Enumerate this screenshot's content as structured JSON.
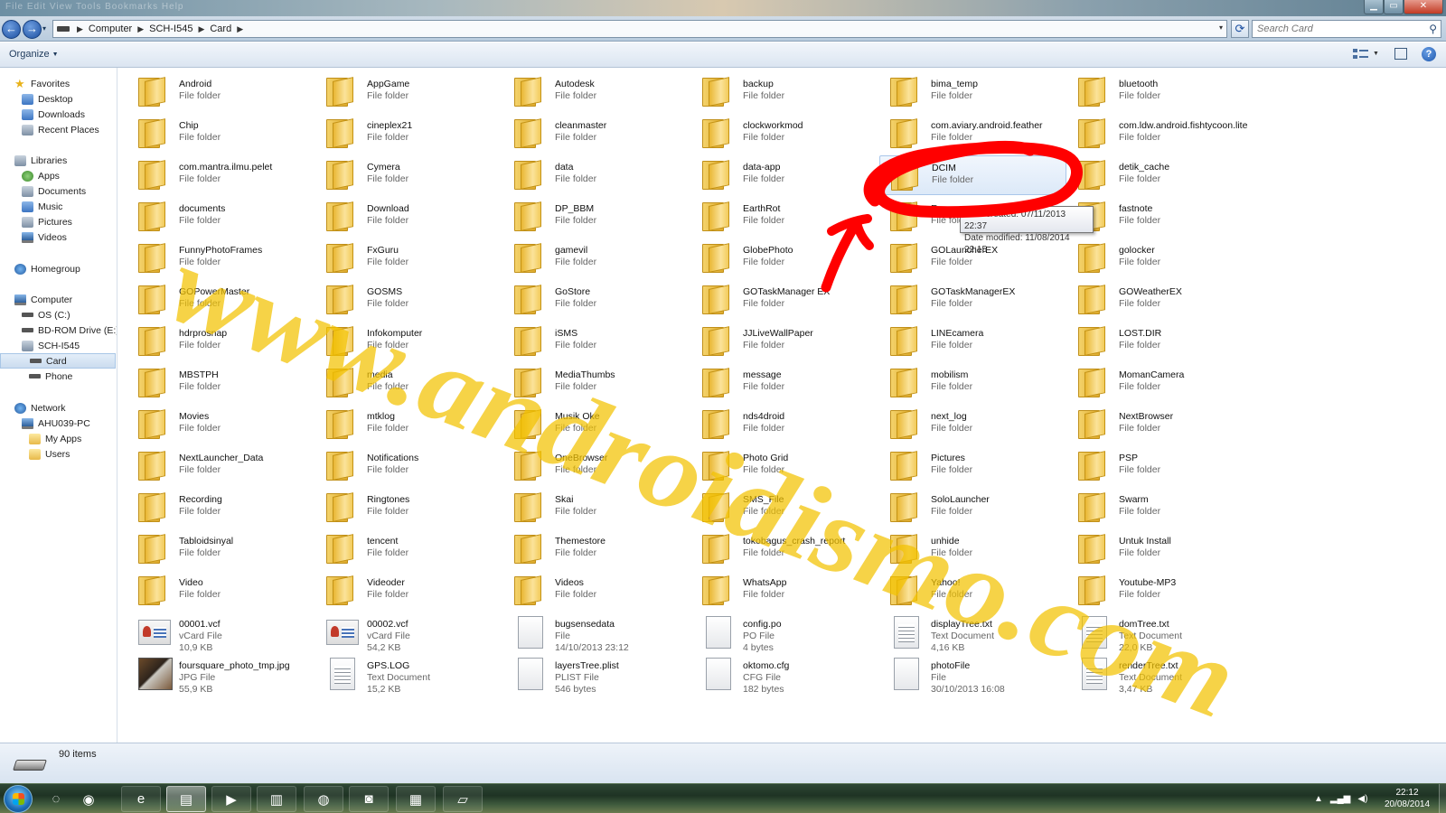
{
  "window": {
    "menu_hint": "File  Edit  View  Tools  Bookmarks  Help",
    "minimize_glyph": "▁",
    "maximize_glyph": "▭",
    "close_glyph": "✕"
  },
  "navigation": {
    "back_glyph": "←",
    "forward_glyph": "→",
    "dropdown_glyph": "▾",
    "breadcrumb": [
      "Computer",
      "SCH-I545",
      "Card"
    ],
    "refresh_glyph": "⟳",
    "search_placeholder": "Search Card",
    "search_icon": "search-icon"
  },
  "toolbar": {
    "organize_label": "Organize",
    "organize_arrow": "▼",
    "views_arrow": "▼",
    "help_label": "?"
  },
  "nav_pane": {
    "items": [
      {
        "label": "Favorites",
        "level": 0,
        "icon": "star",
        "header": true
      },
      {
        "label": "Desktop",
        "level": 1,
        "icon": "folder-blue"
      },
      {
        "label": "Downloads",
        "level": 1,
        "icon": "folder-blue"
      },
      {
        "label": "Recent Places",
        "level": 1,
        "icon": "lib"
      },
      {
        "label": "Libraries",
        "level": 0,
        "icon": "lib",
        "header": true
      },
      {
        "label": "Apps",
        "level": 1,
        "icon": "green"
      },
      {
        "label": "Documents",
        "level": 1,
        "icon": "lib"
      },
      {
        "label": "Music",
        "level": 1,
        "icon": "folder-blue"
      },
      {
        "label": "Pictures",
        "level": 1,
        "icon": "lib"
      },
      {
        "label": "Videos",
        "level": 1,
        "icon": "pc"
      },
      {
        "label": "Homegroup",
        "level": 0,
        "icon": "net",
        "header": true
      },
      {
        "label": "Computer",
        "level": 0,
        "icon": "pc",
        "header": true
      },
      {
        "label": "OS (C:)",
        "level": 1,
        "icon": "drive"
      },
      {
        "label": "BD-ROM Drive (E:) S",
        "level": 1,
        "icon": "drive"
      },
      {
        "label": "SCH-I545",
        "level": 1,
        "icon": "lib"
      },
      {
        "label": "Card",
        "level": 2,
        "icon": "drive",
        "selected": true
      },
      {
        "label": "Phone",
        "level": 2,
        "icon": "drive"
      },
      {
        "label": "Network",
        "level": 0,
        "icon": "net",
        "header": true
      },
      {
        "label": "AHU039-PC",
        "level": 1,
        "icon": "pc"
      },
      {
        "label": "My Apps",
        "level": 2,
        "icon": "folder-y"
      },
      {
        "label": "Users",
        "level": 2,
        "icon": "folder-y"
      }
    ]
  },
  "files": [
    {
      "name": "Android",
      "type": "File folder"
    },
    {
      "name": "AppGame",
      "type": "File folder"
    },
    {
      "name": "Autodesk",
      "type": "File folder"
    },
    {
      "name": "backup",
      "type": "File folder"
    },
    {
      "name": "bima_temp",
      "type": "File folder"
    },
    {
      "name": "bluetooth",
      "type": "File folder"
    },
    {
      "name": "Chip",
      "type": "File folder"
    },
    {
      "name": "cineplex21",
      "type": "File folder"
    },
    {
      "name": "cleanmaster",
      "type": "File folder"
    },
    {
      "name": "clockworkmod",
      "type": "File folder"
    },
    {
      "name": "com.aviary.android.feather",
      "type": "File folder"
    },
    {
      "name": "com.ldw.android.fishtycoon.lite",
      "type": "File folder"
    },
    {
      "name": "com.mantra.ilmu.pelet",
      "type": "File folder"
    },
    {
      "name": "Cymera",
      "type": "File folder"
    },
    {
      "name": "data",
      "type": "File folder"
    },
    {
      "name": "data-app",
      "type": "File folder"
    },
    {
      "name": "DCIM",
      "type": "File folder",
      "selected": true
    },
    {
      "name": "detik_cache",
      "type": "File folder"
    },
    {
      "name": "documents",
      "type": "File folder"
    },
    {
      "name": "Download",
      "type": "File folder"
    },
    {
      "name": "DP_BBM",
      "type": "File folder"
    },
    {
      "name": "EarthRot",
      "type": "File folder"
    },
    {
      "name": "Emu",
      "type": "File folder"
    },
    {
      "name": "fastnote",
      "type": "File folder"
    },
    {
      "name": "FunnyPhotoFrames",
      "type": "File folder"
    },
    {
      "name": "FxGuru",
      "type": "File folder"
    },
    {
      "name": "gamevil",
      "type": "File folder"
    },
    {
      "name": "GlobePhoto",
      "type": "File folder"
    },
    {
      "name": "GOLauncherEX",
      "type": "File folder"
    },
    {
      "name": "golocker",
      "type": "File folder"
    },
    {
      "name": "GOPowerMaster",
      "type": "File folder"
    },
    {
      "name": "GOSMS",
      "type": "File folder"
    },
    {
      "name": "GoStore",
      "type": "File folder"
    },
    {
      "name": "GOTaskManager EX",
      "type": "File folder"
    },
    {
      "name": "GOTaskManagerEX",
      "type": "File folder"
    },
    {
      "name": "GOWeatherEX",
      "type": "File folder"
    },
    {
      "name": "hdrprosnap",
      "type": "File folder"
    },
    {
      "name": "Infokomputer",
      "type": "File folder"
    },
    {
      "name": "iSMS",
      "type": "File folder"
    },
    {
      "name": "JJLiveWallPaper",
      "type": "File folder"
    },
    {
      "name": "LINEcamera",
      "type": "File folder"
    },
    {
      "name": "LOST.DIR",
      "type": "File folder"
    },
    {
      "name": "MBSTPH",
      "type": "File folder"
    },
    {
      "name": "media",
      "type": "File folder"
    },
    {
      "name": "MediaThumbs",
      "type": "File folder"
    },
    {
      "name": "message",
      "type": "File folder"
    },
    {
      "name": "mobilism",
      "type": "File folder"
    },
    {
      "name": "MomanCamera",
      "type": "File folder"
    },
    {
      "name": "Movies",
      "type": "File folder"
    },
    {
      "name": "mtklog",
      "type": "File folder"
    },
    {
      "name": "Musik Oke",
      "type": "File folder"
    },
    {
      "name": "nds4droid",
      "type": "File folder"
    },
    {
      "name": "next_log",
      "type": "File folder"
    },
    {
      "name": "NextBrowser",
      "type": "File folder"
    },
    {
      "name": "NextLauncher_Data",
      "type": "File folder"
    },
    {
      "name": "Notifications",
      "type": "File folder"
    },
    {
      "name": "OneBrowser",
      "type": "File folder"
    },
    {
      "name": "Photo Grid",
      "type": "File folder"
    },
    {
      "name": "Pictures",
      "type": "File folder"
    },
    {
      "name": "PSP",
      "type": "File folder"
    },
    {
      "name": "Recording",
      "type": "File folder"
    },
    {
      "name": "Ringtones",
      "type": "File folder"
    },
    {
      "name": "Skai",
      "type": "File folder"
    },
    {
      "name": "SMS_File",
      "type": "File folder"
    },
    {
      "name": "SoloLauncher",
      "type": "File folder"
    },
    {
      "name": "Swarm",
      "type": "File folder"
    },
    {
      "name": "Tabloidsinyal",
      "type": "File folder"
    },
    {
      "name": "tencent",
      "type": "File folder"
    },
    {
      "name": "Themestore",
      "type": "File folder"
    },
    {
      "name": "tokobagus_crash_report",
      "type": "File folder"
    },
    {
      "name": "unhide",
      "type": "File folder"
    },
    {
      "name": "Untuk Install",
      "type": "File folder"
    },
    {
      "name": "Video",
      "type": "File folder"
    },
    {
      "name": "Videoder",
      "type": "File folder"
    },
    {
      "name": "Videos",
      "type": "File folder"
    },
    {
      "name": "WhatsApp",
      "type": "File folder"
    },
    {
      "name": "Yahoo!",
      "type": "File folder"
    },
    {
      "name": "Youtube-MP3",
      "type": "File folder"
    },
    {
      "name": "00001.vcf",
      "type": "vCard File",
      "meta": "10,9 KB",
      "icon": "vcf"
    },
    {
      "name": "00002.vcf",
      "type": "vCard File",
      "meta": "54,2 KB",
      "icon": "vcf"
    },
    {
      "name": "bugsensedata",
      "type": "File",
      "meta": "14/10/2013 23:12",
      "icon": "file"
    },
    {
      "name": "config.po",
      "type": "PO File",
      "meta": "4 bytes",
      "icon": "file"
    },
    {
      "name": "displayTree.txt",
      "type": "Text Document",
      "meta": "4,16 KB",
      "icon": "txt"
    },
    {
      "name": "domTree.txt",
      "type": "Text Document",
      "meta": "22,0 KB",
      "icon": "txt"
    },
    {
      "name": "foursquare_photo_tmp.jpg",
      "type": "JPG File",
      "meta": "55,9 KB",
      "icon": "jpg"
    },
    {
      "name": "GPS.LOG",
      "type": "Text Document",
      "meta": "15,2 KB",
      "icon": "txt"
    },
    {
      "name": "layersTree.plist",
      "type": "PLIST File",
      "meta": "546 bytes",
      "icon": "file"
    },
    {
      "name": "oktomo.cfg",
      "type": "CFG File",
      "meta": "182 bytes",
      "icon": "file"
    },
    {
      "name": "photoFile",
      "type": "File",
      "meta": "30/10/2013 16:08",
      "icon": "file"
    },
    {
      "name": "renderTree.txt",
      "type": "Text Document",
      "meta": "3,47 KB",
      "icon": "txt"
    }
  ],
  "tooltip": {
    "created": "Date created: 07/11/2013 22:37",
    "modified": "Date modified: 11/08/2014 22:15"
  },
  "watermark": {
    "text": "www.androidismo.com",
    "color": "#f2c200"
  },
  "annotation": {
    "color": "#ff0000"
  },
  "status": {
    "item_count": "90 items"
  },
  "taskbar": {
    "apps": [
      {
        "name": "search-icon",
        "glyph": "◌",
        "state": "plain"
      },
      {
        "name": "chrome-icon",
        "glyph": "◉",
        "state": "plain"
      },
      {
        "name": "ie-icon",
        "glyph": "e",
        "state": "pinned"
      },
      {
        "name": "explorer-icon",
        "glyph": "▤",
        "state": "active"
      },
      {
        "name": "media-player-icon",
        "glyph": "▶",
        "state": "pinned"
      },
      {
        "name": "book-icon",
        "glyph": "▥",
        "state": "pinned"
      },
      {
        "name": "firefox-icon",
        "glyph": "◍",
        "state": "pinned"
      },
      {
        "name": "camera-app-icon",
        "glyph": "◙",
        "state": "pinned"
      },
      {
        "name": "remote-desktop-icon",
        "glyph": "▦",
        "state": "pinned"
      },
      {
        "name": "notepad-icon",
        "glyph": "▱",
        "state": "pinned"
      }
    ],
    "tray": {
      "arrow": "▲",
      "signal": "▂▄▆",
      "volume": "◀)"
    },
    "clock": {
      "time": "22:12",
      "date": "20/08/2014"
    }
  }
}
